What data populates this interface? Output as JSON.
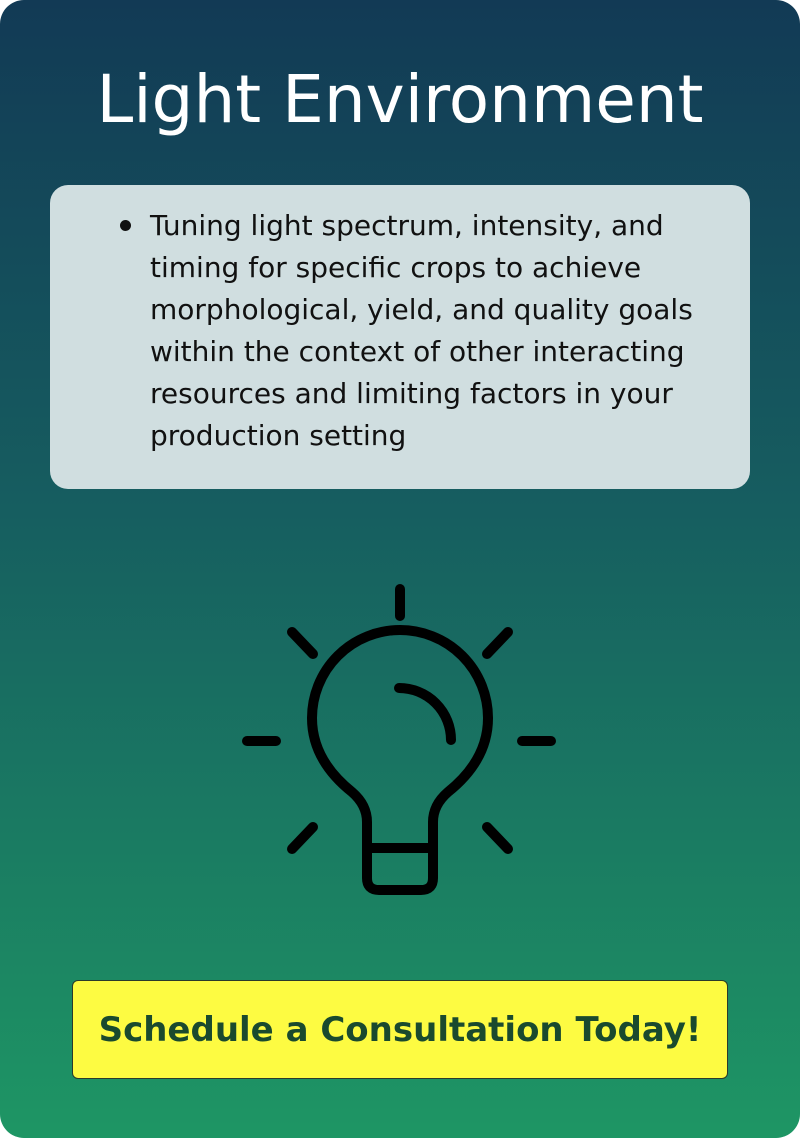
{
  "header": {
    "title": "Light Environment"
  },
  "description": {
    "items": [
      "Tuning light spectrum, intensity, and timing for specific crops to achieve morphological, yield, and quality goals within the context of other interacting resources and limiting factors in your production setting"
    ]
  },
  "icon": {
    "name": "lightbulb-icon"
  },
  "cta": {
    "label": "Schedule a Consultation Today!"
  },
  "colors": {
    "gradient_top": "#123a55",
    "gradient_bottom": "#1e9664",
    "box_background": "#d0dee0",
    "cta_background": "#fdfb42",
    "cta_text": "#1a4a2e"
  }
}
